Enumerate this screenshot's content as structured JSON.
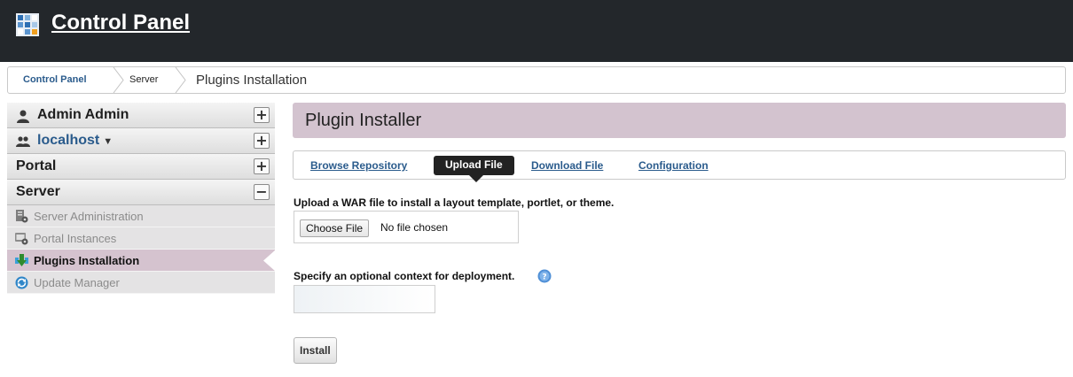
{
  "header": {
    "title": "Control Panel"
  },
  "breadcrumb": {
    "items": [
      "Control Panel",
      "Server",
      "Plugins Installation"
    ]
  },
  "sidebar": {
    "panels": [
      {
        "label": "Admin Admin",
        "toggle": "+"
      },
      {
        "label": "localhost",
        "toggle": "+",
        "caret": "▼"
      },
      {
        "label": "Portal",
        "toggle": "+"
      },
      {
        "label": "Server",
        "toggle": "−"
      }
    ],
    "server_items": [
      "Server Administration",
      "Portal Instances",
      "Plugins Installation",
      "Update Manager"
    ]
  },
  "main": {
    "title": "Plugin Installer",
    "tabs": [
      "Browse Repository",
      "Upload File",
      "Download File",
      "Configuration"
    ],
    "upload_instruction": "Upload a WAR file to install a layout template, portlet, or theme.",
    "choose_file_label": "Choose File",
    "no_file_text": "No file chosen",
    "context_label": "Specify an optional context for deployment.",
    "context_value": "",
    "install_label": "Install"
  },
  "colors": {
    "topbar": "#23272b",
    "link": "#2a5b8c",
    "header_bg": "#d3c3cf",
    "active_nav": "#d5c3cf"
  }
}
